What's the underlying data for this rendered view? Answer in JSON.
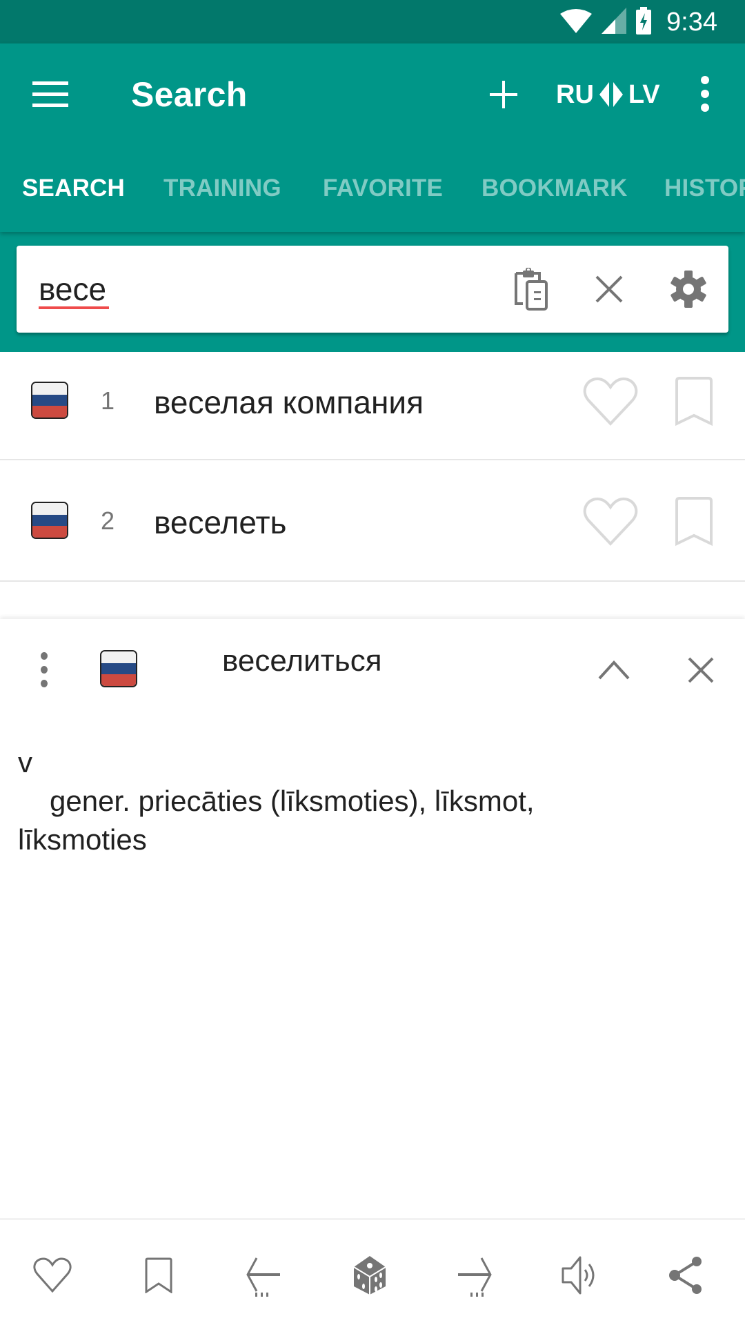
{
  "status_bar": {
    "time": "9:34",
    "icons": [
      "wifi-icon",
      "cell-signal-icon",
      "battery-charging-icon"
    ]
  },
  "toolbar": {
    "menu_icon": "hamburger-menu-icon",
    "title": "Search",
    "add_icon": "plus-icon",
    "language_from": "RU",
    "language_to": "LV",
    "swap_icon": "swap-arrows-icon",
    "more_icon": "more-vert-icon"
  },
  "tabs": [
    {
      "label": "SEARCH",
      "active": true
    },
    {
      "label": "TRAINING",
      "active": false
    },
    {
      "label": "FAVORITE",
      "active": false
    },
    {
      "label": "BOOKMARK",
      "active": false
    },
    {
      "label": "HISTORY",
      "active": false
    }
  ],
  "search": {
    "value": "весе",
    "paste_icon": "paste-clipboard-icon",
    "clear_icon": "close-icon",
    "settings_icon": "gear-icon"
  },
  "results": [
    {
      "number": "1",
      "text": "веселая компания",
      "flag": "russia-flag"
    },
    {
      "number": "2",
      "text": "веселеть",
      "flag": "russia-flag"
    }
  ],
  "colors": {
    "primary": "#009688",
    "primary_dark": "#02786b",
    "tab_inactive": "rgba(255,255,255,0.5)",
    "icon_gray": "#757575",
    "icon_light": "#d9d9d9",
    "spell_error": "#ef4b4b"
  },
  "detail_panel": {
    "word": "веселиться",
    "flag": "russia-flag",
    "part_of_speech": "v",
    "definition_line": "gener. priecāties (līksmoties), līksmot,",
    "definition_cont": "līksmoties"
  },
  "bottom_bar": {
    "buttons": [
      {
        "name": "favorite",
        "icon": "heart-outline-icon"
      },
      {
        "name": "bookmark",
        "icon": "bookmark-outline-icon"
      },
      {
        "name": "previous",
        "icon": "arrow-left-icon"
      },
      {
        "name": "random",
        "icon": "dice-icon"
      },
      {
        "name": "next",
        "icon": "arrow-right-icon"
      },
      {
        "name": "speak",
        "icon": "speaker-icon"
      },
      {
        "name": "share",
        "icon": "share-icon"
      }
    ]
  }
}
